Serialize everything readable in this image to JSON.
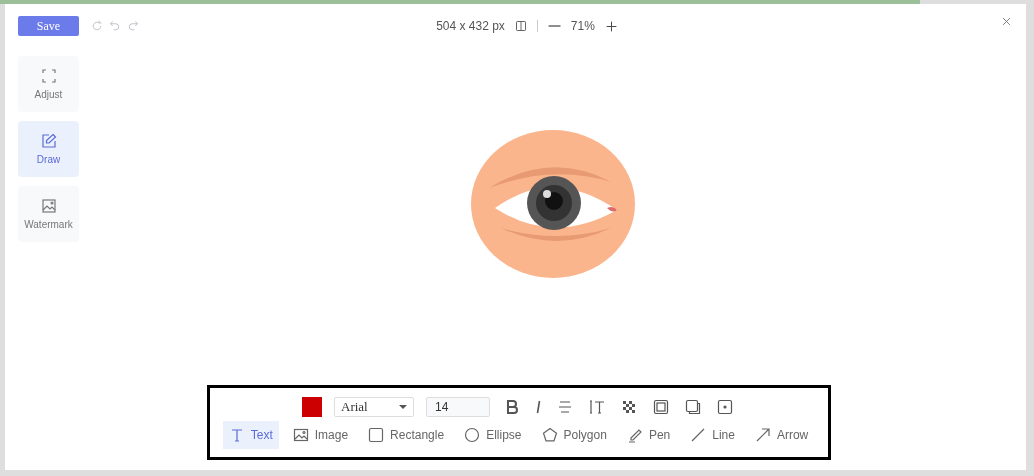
{
  "header": {
    "save": "Save",
    "dimensions": "504 x 432 px",
    "zoom": "71%"
  },
  "sidebar": [
    {
      "label": "Adjust",
      "selected": false
    },
    {
      "label": "Draw",
      "selected": true
    },
    {
      "label": "Watermark",
      "selected": false
    }
  ],
  "toolbar": {
    "color": "#cc0000",
    "font": "Arial",
    "size": "14",
    "tools": [
      {
        "label": "Text",
        "selected": true
      },
      {
        "label": "Image",
        "selected": false
      },
      {
        "label": "Rectangle",
        "selected": false
      },
      {
        "label": "Ellipse",
        "selected": false
      },
      {
        "label": "Polygon",
        "selected": false
      },
      {
        "label": "Pen",
        "selected": false
      },
      {
        "label": "Line",
        "selected": false
      },
      {
        "label": "Arrow",
        "selected": false
      }
    ]
  }
}
